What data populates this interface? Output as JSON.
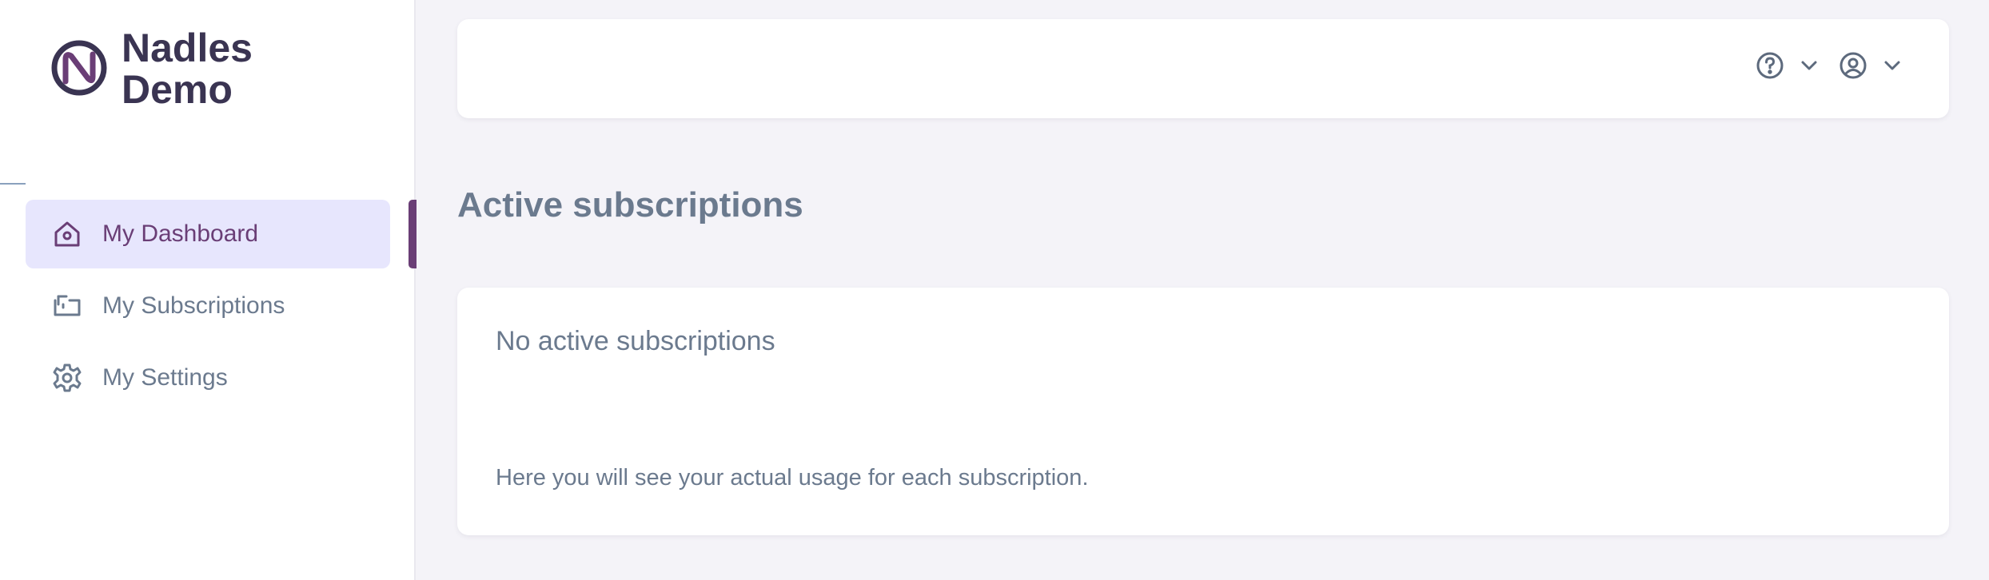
{
  "brand": {
    "name_line1": "Nadles",
    "name_line2": "Demo",
    "logo_icon": "nadles-logo-icon",
    "colors": {
      "primary": "#6a3e76",
      "dark": "#3a3452",
      "active_bg": "#e7e6fd",
      "muted_text": "#6b7a8e"
    }
  },
  "sidebar": {
    "items": [
      {
        "label": "My Dashboard",
        "icon": "home-icon",
        "active": true
      },
      {
        "label": "My Subscriptions",
        "icon": "subscriptions-icon",
        "active": false
      },
      {
        "label": "My Settings",
        "icon": "gear-icon",
        "active": false
      }
    ]
  },
  "topbar": {
    "help_icon": "help-icon",
    "user_icon": "user-icon",
    "chevron_icon": "chevron-down-icon"
  },
  "main": {
    "section_title": "Active subscriptions",
    "card": {
      "title": "No active subscriptions",
      "text": "Here you will see your actual usage for each subscription."
    }
  }
}
